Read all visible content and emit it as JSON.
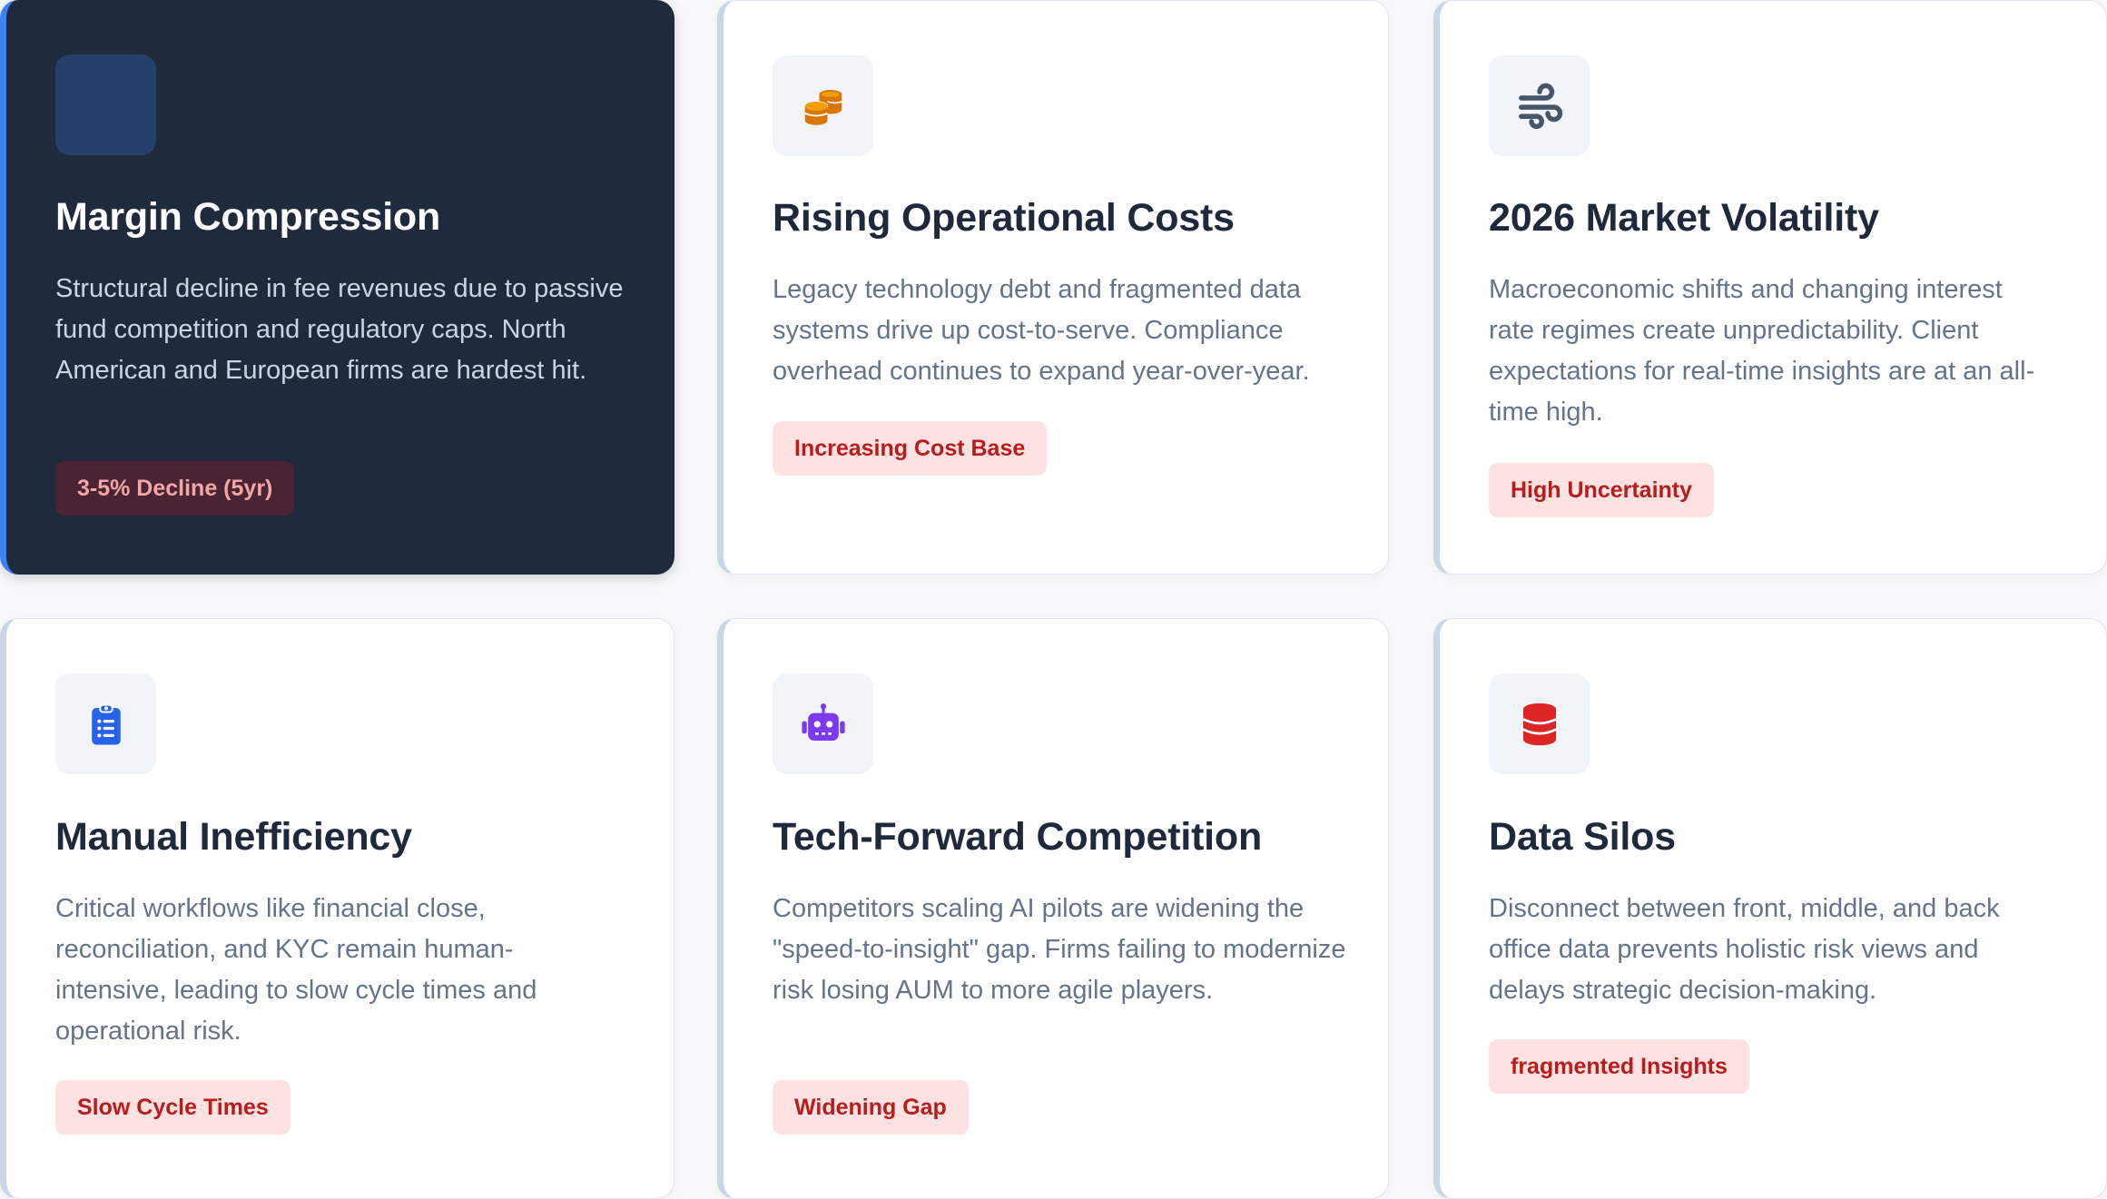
{
  "cards": [
    {
      "title": "Margin Compression",
      "description": "Structural decline in fee revenues due to passive fund competition and regulatory caps. North American and European firms are hardest hit.",
      "tag": "3-5% Decline (5yr)",
      "icon": "blank-icon"
    },
    {
      "title": "Rising Operational Costs",
      "description": "Legacy technology debt and fragmented data systems drive up cost-to-serve. Compliance overhead continues to expand year-over-year.",
      "tag": "Increasing Cost Base",
      "icon": "coins-icon"
    },
    {
      "title": "2026 Market Volatility",
      "description": "Macroeconomic shifts and changing interest rate regimes create unpredictability. Client expectations for real-time insights are at an all-time high.",
      "tag": "High Uncertainty",
      "icon": "wind-icon"
    },
    {
      "title": "Manual Inefficiency",
      "description": "Critical workflows like financial close, reconciliation, and KYC remain human-intensive, leading to slow cycle times and operational risk.",
      "tag": "Slow Cycle Times",
      "icon": "clipboard-list-icon"
    },
    {
      "title": "Tech-Forward Competition",
      "description": "Competitors scaling AI pilots are widening the \"speed-to-insight\" gap. Firms failing to modernize risk losing AUM to more agile players.",
      "tag": "Widening Gap",
      "icon": "robot-icon"
    },
    {
      "title": "Data Silos",
      "description": "Disconnect between front, middle, and back office data prevents holistic risk views and delays strategic decision-making.",
      "tag": "fragmented Insights",
      "icon": "database-icon"
    }
  ],
  "colors": {
    "accent_blue": "#3b82f6",
    "dark_card": "#1f2a3c",
    "tag_background": "#fee2e2",
    "tag_text": "#b91c1c",
    "coins": "#d97706",
    "wind": "#475569",
    "clipboard": "#2563eb",
    "robot": "#7c3aed",
    "database": "#dc2626"
  }
}
